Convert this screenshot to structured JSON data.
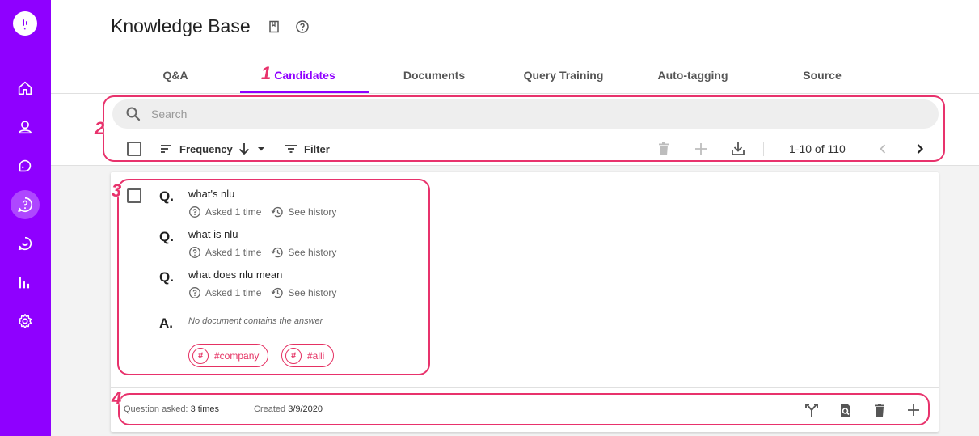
{
  "app": {
    "page_title": "Knowledge Base"
  },
  "sidebar": {
    "items": [
      {
        "icon": "home-icon"
      },
      {
        "icon": "user-icon"
      },
      {
        "icon": "chat-icon"
      },
      {
        "icon": "help-circle-icon",
        "active": true
      },
      {
        "icon": "message-icon"
      },
      {
        "icon": "bar-chart-icon"
      },
      {
        "icon": "gear-icon"
      }
    ]
  },
  "tabs": [
    {
      "label": "Q&A"
    },
    {
      "label": "Candidates",
      "active": true
    },
    {
      "label": "Documents"
    },
    {
      "label": "Query Training"
    },
    {
      "label": "Auto-tagging"
    },
    {
      "label": "Source"
    }
  ],
  "toolbar": {
    "search_placeholder": "Search",
    "sort_label": "Frequency",
    "filter_label": "Filter",
    "pager": "1-10 of 110"
  },
  "candidate": {
    "questions": [
      {
        "letter": "Q.",
        "text": "what's nlu",
        "asked": "Asked 1 time",
        "history": "See history"
      },
      {
        "letter": "Q.",
        "text": "what is nlu",
        "asked": "Asked 1 time",
        "history": "See history"
      },
      {
        "letter": "Q.",
        "text": "what does nlu mean",
        "asked": "Asked 1 time",
        "history": "See history"
      }
    ],
    "answer_letter": "A.",
    "answer": "No document contains the answer",
    "tags": [
      "#company",
      "#alli"
    ],
    "footer": {
      "asked_label": "Question asked:",
      "asked_value": "3 times",
      "created_label": "Created",
      "created_value": "3/9/2020"
    }
  },
  "annotations": [
    "1",
    "2",
    "3",
    "4"
  ],
  "colors": {
    "brand": "#8f00ff",
    "annotation": "#e8326c",
    "tag": "#e53163"
  }
}
